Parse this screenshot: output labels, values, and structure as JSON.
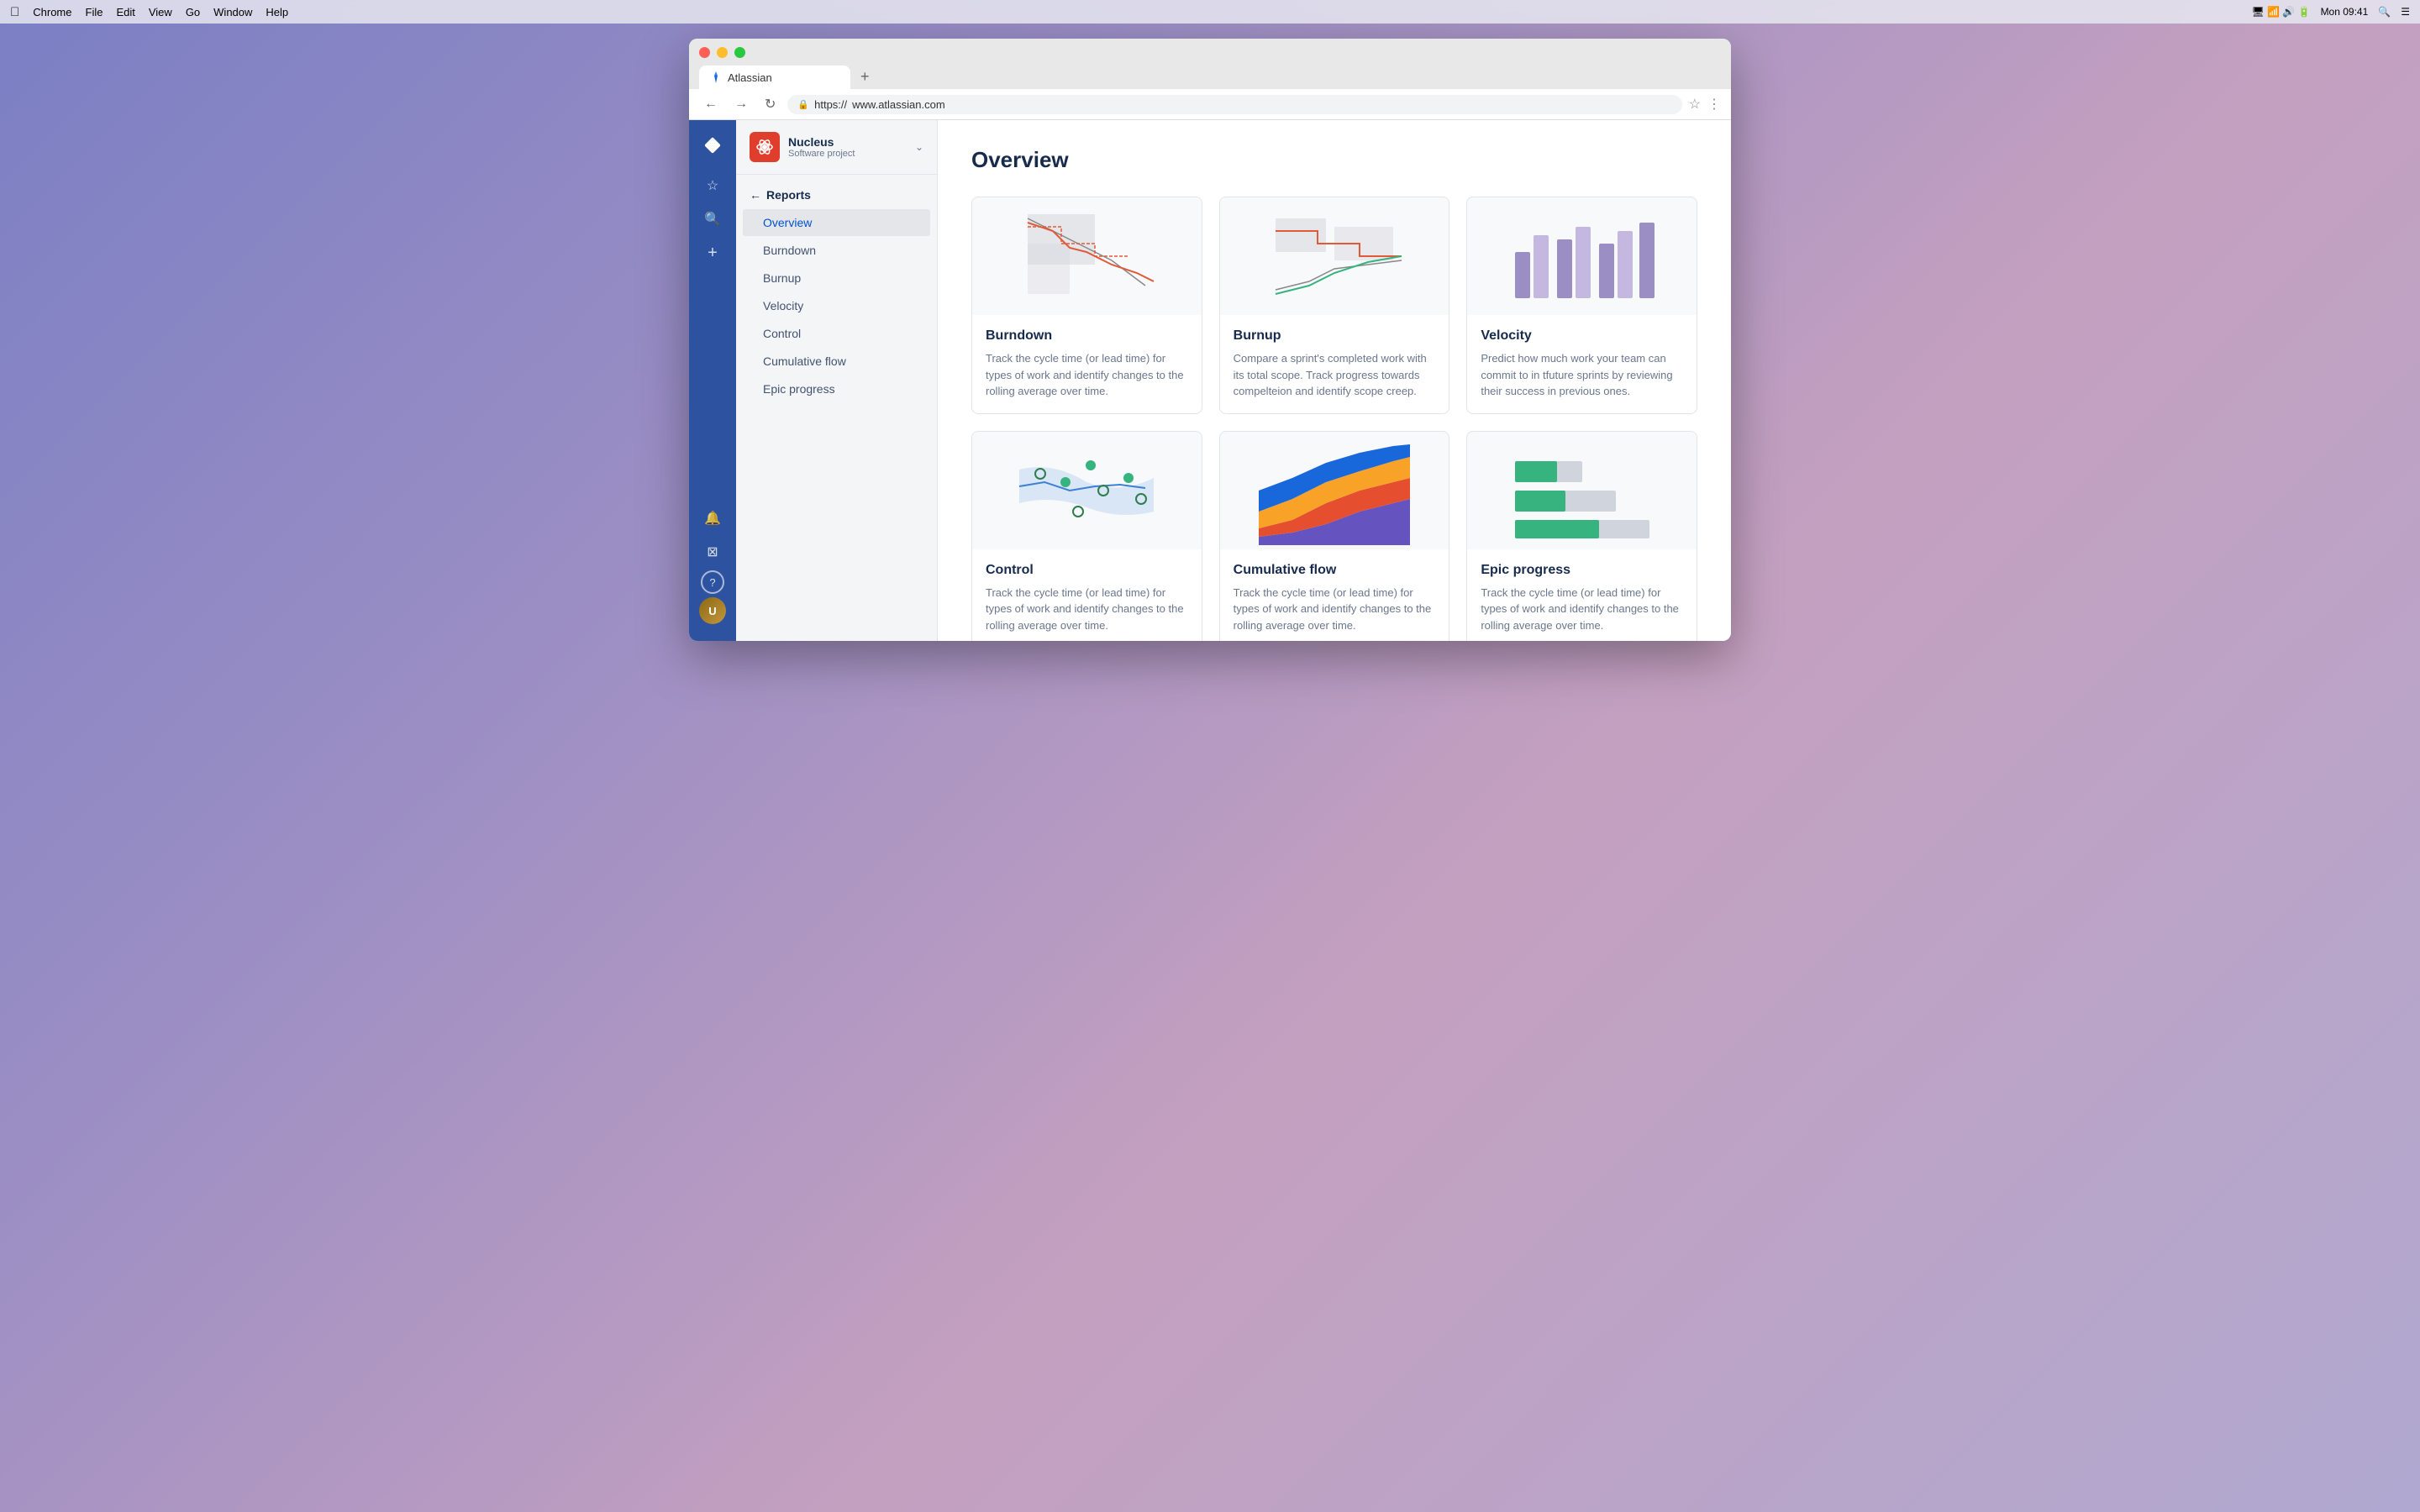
{
  "menubar": {
    "apple": "⌘",
    "items": [
      "Chrome",
      "File",
      "Edit",
      "View",
      "Go",
      "Window",
      "Help"
    ],
    "time": "Mon 09:41"
  },
  "browser": {
    "tab_title": "Atlassian",
    "url_prefix": "https://",
    "url": "www.atlassian.com",
    "add_tab": "+"
  },
  "nav_rail": {
    "diamond_icon": "◆",
    "icons": [
      {
        "name": "star-icon",
        "symbol": "☆",
        "interactable": true
      },
      {
        "name": "search-icon",
        "symbol": "⌕",
        "interactable": true
      },
      {
        "name": "add-icon",
        "symbol": "+",
        "interactable": true
      }
    ],
    "bottom_icons": [
      {
        "name": "bell-icon",
        "symbol": "🔔",
        "interactable": true
      },
      {
        "name": "grid-icon",
        "symbol": "⊞",
        "interactable": true
      },
      {
        "name": "help-icon",
        "symbol": "?",
        "interactable": true
      }
    ]
  },
  "sidebar": {
    "project_name": "Nucleus",
    "project_type": "Software project",
    "back_label": "Reports",
    "nav_items": [
      {
        "label": "Overview",
        "active": true
      },
      {
        "label": "Burndown",
        "active": false
      },
      {
        "label": "Burnup",
        "active": false
      },
      {
        "label": "Velocity",
        "active": false
      },
      {
        "label": "Control",
        "active": false
      },
      {
        "label": "Cumulative flow",
        "active": false
      },
      {
        "label": "Epic progress",
        "active": false
      }
    ]
  },
  "main": {
    "page_title": "Overview",
    "cards": [
      {
        "id": "burndown",
        "title": "Burndown",
        "description": "Track the cycle time (or lead time) for types of work and identify changes to the rolling average over time.",
        "chart_type": "burndown"
      },
      {
        "id": "burnup",
        "title": "Burnup",
        "description": "Compare a sprint's completed work with its total scope. Track progress towards compelteion and identify scope creep.",
        "chart_type": "burnup"
      },
      {
        "id": "velocity",
        "title": "Velocity",
        "description": "Predict how much work your team can commit to in tfuture sprints by reviewing their success in previous ones.",
        "chart_type": "velocity"
      },
      {
        "id": "control",
        "title": "Control",
        "description": "Track the cycle time (or lead time) for types of work and identify changes to the rolling average over time.",
        "chart_type": "control"
      },
      {
        "id": "cumulative-flow",
        "title": "Cumulative flow",
        "description": "Track the cycle time (or lead time) for types of work and identify changes to the rolling average over time.",
        "chart_type": "cumulative"
      },
      {
        "id": "epic-progress",
        "title": "Epic progress",
        "description": "Track the cycle time (or lead time) for types of work and identify changes to the rolling average over time.",
        "chart_type": "epic"
      }
    ]
  }
}
